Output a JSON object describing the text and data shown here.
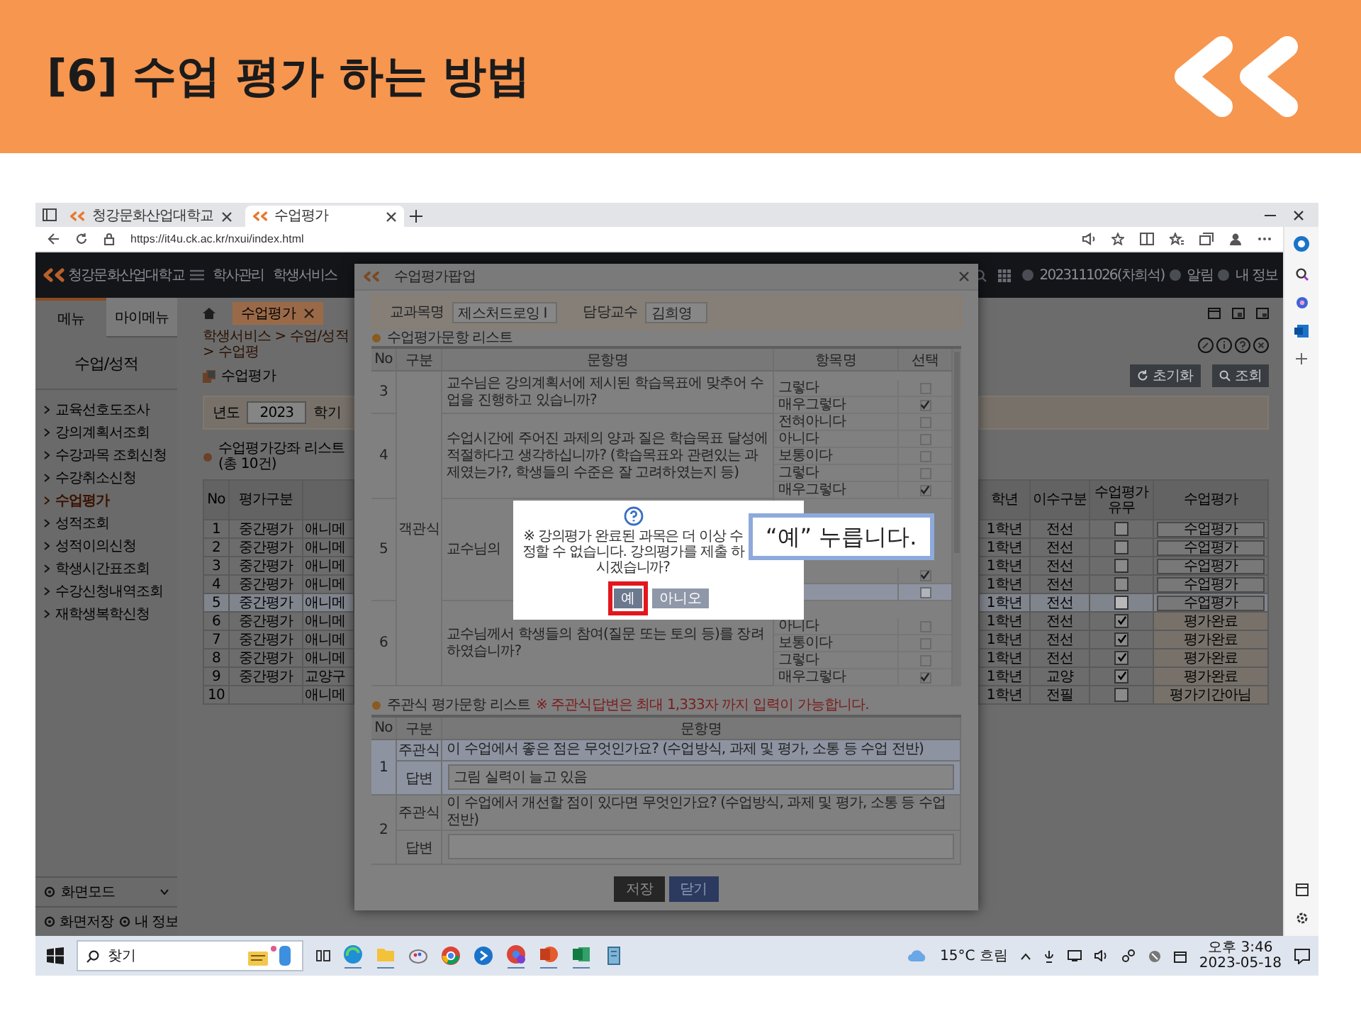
{
  "slide": {
    "title": "[6] 수업 평가 하는 방법"
  },
  "browser": {
    "tabs": [
      {
        "label": "청강문화산업대학교",
        "selected": false
      },
      {
        "label": "수업평가",
        "selected": true
      }
    ],
    "url": "https://it4u.ck.ac.kr/nxui/index.html"
  },
  "app_header": {
    "school": "청강문화산업대학교",
    "menus": [
      "학사관리",
      "학생서비스"
    ],
    "user": "2023111026(차희석)",
    "alerts": "알림",
    "account": "내 정보"
  },
  "sidebar": {
    "tabs": [
      {
        "label": "메뉴",
        "selected": true
      },
      {
        "label": "마이메뉴",
        "selected": false
      }
    ],
    "section": "수업/성적",
    "items": [
      {
        "label": "교육선호도조사",
        "selected": false
      },
      {
        "label": "강의계획서조회",
        "selected": false
      },
      {
        "label": "수강과목 조회신청",
        "selected": false
      },
      {
        "label": "수강취소신청",
        "selected": false
      },
      {
        "label": "수업평가",
        "selected": true
      },
      {
        "label": "성적조회",
        "selected": false
      },
      {
        "label": "성적이의신청",
        "selected": false
      },
      {
        "label": "학생시간표조회",
        "selected": false
      },
      {
        "label": "수강신청내역조회",
        "selected": false
      },
      {
        "label": "재학생복학신청",
        "selected": false
      }
    ],
    "screen_mode": "화면모드",
    "footer_links": [
      "화면저장",
      "내 정보"
    ]
  },
  "content": {
    "tab": "수업평가",
    "breadcrumb": "학생서비스 > 수업/성적 > 수업평",
    "page_title": "수업평가",
    "filters": [
      {
        "label": "년도",
        "value": "2023"
      },
      {
        "label": "학기"
      }
    ],
    "list_title": "수업평가강좌 리스트",
    "count": "(총 10건)",
    "buttons": [
      "초기화",
      "조회"
    ],
    "table": {
      "columns": [
        "No",
        "평가구분",
        "학년",
        "이수구분",
        "수업평가 유무",
        "수업평가"
      ],
      "rows": [
        {
          "no": "1",
          "type": "중간평가",
          "column_3": "애니메",
          "grade": "1학년",
          "category": "전선",
          "evaluated": false,
          "action": "수업평가",
          "kind": "button",
          "selected": false
        },
        {
          "no": "2",
          "type": "중간평가",
          "column_3": "애니메",
          "grade": "1학년",
          "category": "전선",
          "evaluated": false,
          "action": "수업평가",
          "kind": "button",
          "selected": false
        },
        {
          "no": "3",
          "type": "중간평가",
          "column_3": "애니메",
          "grade": "1학년",
          "category": "전선",
          "evaluated": false,
          "action": "수업평가",
          "kind": "button",
          "selected": false
        },
        {
          "no": "4",
          "type": "중간평가",
          "column_3": "애니메",
          "grade": "1학년",
          "category": "전선",
          "evaluated": false,
          "action": "수업평가",
          "kind": "button",
          "selected": false
        },
        {
          "no": "5",
          "type": "중간평가",
          "column_3": "애니메",
          "grade": "1학년",
          "category": "전선",
          "evaluated": false,
          "action": "수업평가",
          "kind": "button",
          "selected": true
        },
        {
          "no": "6",
          "type": "중간평가",
          "column_3": "애니메",
          "grade": "1학년",
          "category": "전선",
          "evaluated": true,
          "action": "평가완료",
          "kind": "status",
          "selected": false
        },
        {
          "no": "7",
          "type": "중간평가",
          "column_3": "애니메",
          "grade": "1학년",
          "category": "전선",
          "evaluated": true,
          "action": "평가완료",
          "kind": "status",
          "selected": false
        },
        {
          "no": "8",
          "type": "중간평가",
          "column_3": "애니메",
          "grade": "1학년",
          "category": "전선",
          "evaluated": true,
          "action": "평가완료",
          "kind": "status",
          "selected": false
        },
        {
          "no": "9",
          "type": "중간평가",
          "column_3": "교양구",
          "grade": "1학년",
          "category": "교양",
          "evaluated": true,
          "action": "평가완료",
          "kind": "status",
          "selected": false
        },
        {
          "no": "10",
          "column_3": "애니메",
          "grade": "1학년",
          "category": "전필",
          "evaluated": false,
          "action": "평가기간아님",
          "kind": "status",
          "selected": false
        }
      ]
    }
  },
  "modal": {
    "title": "수업평가팝업",
    "fields": [
      {
        "label": "교과목명",
        "value": "제스처드로잉 I"
      },
      {
        "label": "담당교수",
        "value": "김희영"
      }
    ],
    "objective": {
      "title": "수업평가문항 리스트",
      "columns": [
        "No",
        "구분",
        "문항명",
        "항목명",
        "선택"
      ],
      "group": "객관식",
      "questions": [
        {
          "no": "3",
          "text": "교수님은 강의계획서에 제시된 학습목표에 맞추어 수업을 진행하고 있습니까?",
          "options": [
            {
              "label": "그렇다",
              "checked": false,
              "selected": false
            },
            {
              "label": "매우그렇다",
              "checked": true,
              "selected": false
            }
          ]
        },
        {
          "no": "4",
          "text": "수업시간에 주어진 과제의 양과 질은 학습목표 달성에 적절하다고 생각하십니까? (학습목표와 관련있는 과제였는가?, 학생들의 수준은 잘 고려하였는지 등)",
          "options": [
            {
              "label": "전혀아니다",
              "checked": false,
              "selected": false
            },
            {
              "label": "아니다",
              "checked": false,
              "selected": false
            },
            {
              "label": "보통이다",
              "checked": false,
              "selected": false
            },
            {
              "label": "그렇다",
              "checked": false,
              "selected": false
            },
            {
              "label": "매우그렇다",
              "checked": true,
              "selected": false
            }
          ]
        },
        {
          "no": "5",
          "text": "교수님의",
          "options": [
            {
              "checked": true,
              "selected": false
            },
            {
              "checked": false,
              "selected": true
            }
          ]
        },
        {
          "no": "6",
          "text": "교수님께서 학생들의 참여(질문 또는 토의 등)를 장려하였습니까?",
          "options": [
            {
              "label": "아니다",
              "checked": false,
              "selected": false
            },
            {
              "label": "보통이다",
              "checked": false,
              "selected": false
            },
            {
              "label": "그렇다",
              "checked": false,
              "selected": false
            },
            {
              "label": "매우그렇다",
              "checked": true,
              "selected": false
            }
          ]
        }
      ]
    },
    "subjective": {
      "title": "주관식 평가문항 리스트",
      "note": "※ 주관식답변은 최대 1,333자 까지 입력이 가능합니다.",
      "columns": [
        "No",
        "구분",
        "문항명"
      ],
      "items": [
        {
          "no": "1",
          "kind_label": "주관식",
          "question": "이 수업에서 좋은 점은 무엇인가요? (수업방식, 과제 및 평가, 소통 등 수업 전반)",
          "answer_label": "답변",
          "answer": "그림 실력이 늘고 있음",
          "selected": true
        },
        {
          "no": "2",
          "kind_label": "주관식",
          "question": "이 수업에서 개선할 점이 있다면 무엇인가요? (수업방식, 과제 및 평가, 소통 등 수업 전반)",
          "answer_label": "답변",
          "selected": false
        }
      ]
    },
    "buttons": [
      {
        "label": "저장",
        "kind": "dark"
      },
      {
        "label": "닫기",
        "kind": "primary"
      }
    ]
  },
  "confirm": {
    "message": "※ 강의평가 완료된 과목은 더 이상 수정할 수 없습니다. 강의평가를 제출 하시겠습니까?",
    "buttons": [
      {
        "label": "예",
        "highlighted": true
      },
      {
        "label": "아니오",
        "highlighted": false
      }
    ]
  },
  "callout": "“예” 누릅니다.",
  "taskbar": {
    "search": "찾기",
    "weather": "15°C 흐림",
    "time": "오후 3:46",
    "date": "2023-05-18"
  }
}
